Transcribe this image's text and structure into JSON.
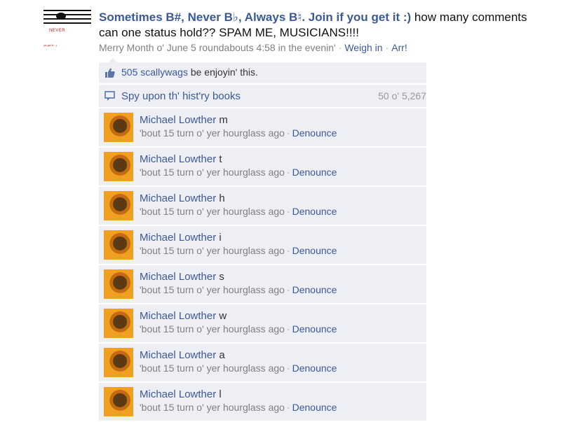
{
  "story": {
    "actor": "Sometimes B#, Never B♭, Always B♮. Join if you get it :)",
    "message": "how many comments can one status hold?? SPAM ME, MUSICIANS!!!!",
    "logo_text": "NEVER",
    "logo_caption": "ya get it :-)",
    "timestamp": "Merry Month o' June 5 roundabouts 4:58 in the evenin'",
    "actions": [
      "Weigh in",
      "Arr!"
    ]
  },
  "ufi": {
    "likes_link": "505 scallywags",
    "likes_suffix": "be enjoyin' this.",
    "history_link": "Spy upon th' hist'ry books",
    "count": "50 o' 5,267"
  },
  "comments": [
    {
      "author": "Michael Lowther",
      "text": "m",
      "time": "'bout 15 turn o' yer hourglass ago",
      "action": "Denounce"
    },
    {
      "author": "Michael Lowther",
      "text": "t",
      "time": "'bout 15 turn o' yer hourglass ago",
      "action": "Denounce"
    },
    {
      "author": "Michael Lowther",
      "text": "h",
      "time": "'bout 15 turn o' yer hourglass ago",
      "action": "Denounce"
    },
    {
      "author": "Michael Lowther",
      "text": "i",
      "time": "'bout 15 turn o' yer hourglass ago",
      "action": "Denounce"
    },
    {
      "author": "Michael Lowther",
      "text": "s",
      "time": "'bout 15 turn o' yer hourglass ago",
      "action": "Denounce"
    },
    {
      "author": "Michael Lowther",
      "text": "w",
      "time": "'bout 15 turn o' yer hourglass ago",
      "action": "Denounce"
    },
    {
      "author": "Michael Lowther",
      "text": "a",
      "time": "'bout 15 turn o' yer hourglass ago",
      "action": "Denounce"
    },
    {
      "author": "Michael Lowther",
      "text": "l",
      "time": "'bout 15 turn o' yer hourglass ago",
      "action": "Denounce"
    }
  ],
  "colors": {
    "link": "#3b5998",
    "ufi_bg": "#edeff4",
    "meta": "#808080"
  }
}
